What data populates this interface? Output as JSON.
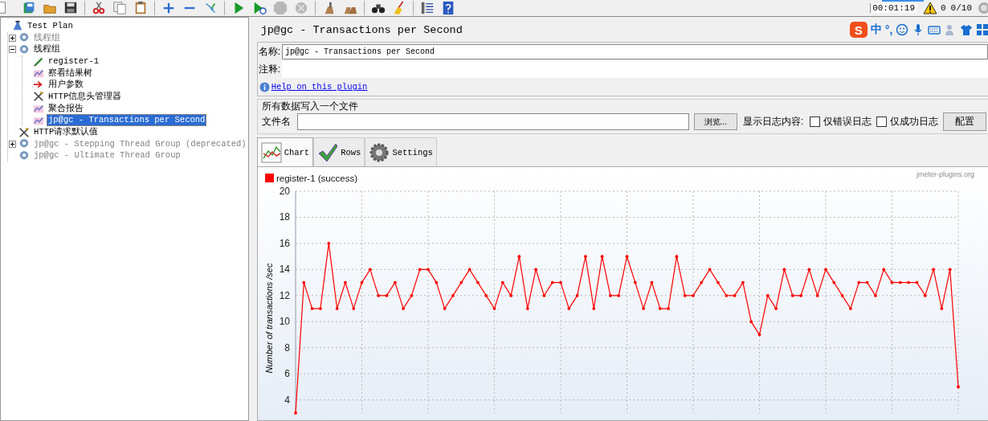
{
  "status": {
    "elapsed": "00:01:19",
    "warnings": "0",
    "threads": "0/10"
  },
  "tree": {
    "items": [
      {
        "label": "Test Plan",
        "kind": "plan",
        "selected": false,
        "disabled": false,
        "children": [
          {
            "label": "线程组",
            "kind": "group",
            "selected": false,
            "disabled": true,
            "expanded": false
          },
          {
            "label": "线程组",
            "kind": "group",
            "selected": false,
            "disabled": false,
            "expanded": true,
            "children": [
              {
                "label": "register-1",
                "kind": "sampler",
                "selected": false,
                "disabled": false
              },
              {
                "label": "察看结果树",
                "kind": "listener",
                "selected": false,
                "disabled": false
              },
              {
                "label": "用户参数",
                "kind": "preprocessor",
                "selected": false,
                "disabled": false
              },
              {
                "label": "HTTP信息头管理器",
                "kind": "config",
                "selected": false,
                "disabled": false
              },
              {
                "label": "聚合报告",
                "kind": "listener",
                "selected": false,
                "disabled": false
              },
              {
                "label": "jp@gc - Transactions per Second",
                "kind": "listener",
                "selected": true,
                "disabled": false
              }
            ]
          },
          {
            "label": "HTTP请求默认值",
            "kind": "config",
            "selected": false,
            "disabled": false
          },
          {
            "label": "jp@gc - Stepping Thread Group (deprecated)",
            "kind": "group",
            "selected": false,
            "disabled": true,
            "expanded": false
          },
          {
            "label": "jp@gc - Ultimate Thread Group",
            "kind": "group",
            "selected": false,
            "disabled": true
          }
        ]
      }
    ]
  },
  "panel": {
    "title": "jp@gc - Transactions per Second",
    "name_label": "名称:",
    "name_value": "jp@gc - Transactions per Second",
    "comment_label": "注释:",
    "help_link": "Help on this plugin"
  },
  "ime_bar": {
    "items": [
      {
        "kind": "logo",
        "text": "S"
      },
      {
        "kind": "text",
        "text": "中"
      },
      {
        "kind": "text",
        "text": "°,"
      },
      {
        "kind": "smiley"
      },
      {
        "kind": "mic"
      },
      {
        "kind": "keyboard"
      },
      {
        "kind": "person"
      },
      {
        "kind": "shirt"
      },
      {
        "kind": "grid"
      }
    ]
  },
  "file_section": {
    "title": "所有数据写入一个文件",
    "file_label": "文件名",
    "browse_button": "浏览...",
    "log_label": "显示日志内容:",
    "checkboxes": [
      {
        "label": "仅错误日志",
        "checked": false
      },
      {
        "label": "仅成功日志",
        "checked": false
      }
    ],
    "config_button": "配置"
  },
  "tabs": [
    {
      "label": "Chart",
      "kind": "chart",
      "selected": true
    },
    {
      "label": "Rows",
      "kind": "check",
      "selected": false
    },
    {
      "label": "Settings",
      "kind": "gear",
      "selected": false
    }
  ],
  "chart": {
    "credit": "jmeter-plugins.org",
    "chart_data": {
      "type": "line",
      "ylabel": "Number of transactions /sec",
      "ylim": [
        3,
        20
      ],
      "grid": true,
      "yticks": [
        4,
        6,
        8,
        10,
        12,
        14,
        16,
        18,
        20
      ],
      "series": [
        {
          "name": "register-1 (success)",
          "color": "#ff0000",
          "values": [
            3,
            13,
            11,
            11,
            16,
            11,
            13,
            11,
            13,
            14,
            12,
            12,
            13,
            11,
            12,
            14,
            14,
            13,
            11,
            12,
            13,
            14,
            13,
            12,
            11,
            13,
            12,
            15,
            11,
            14,
            12,
            13,
            13,
            11,
            12,
            15,
            11,
            15,
            12,
            12,
            15,
            13,
            11,
            13,
            11,
            11,
            15,
            12,
            12,
            13,
            14,
            13,
            12,
            12,
            13,
            10,
            9,
            12,
            11,
            14,
            12,
            12,
            14,
            12,
            14,
            13,
            12,
            11,
            13,
            13,
            12,
            14,
            13,
            13,
            13,
            13,
            12,
            14,
            11,
            14,
            5
          ]
        }
      ]
    }
  }
}
